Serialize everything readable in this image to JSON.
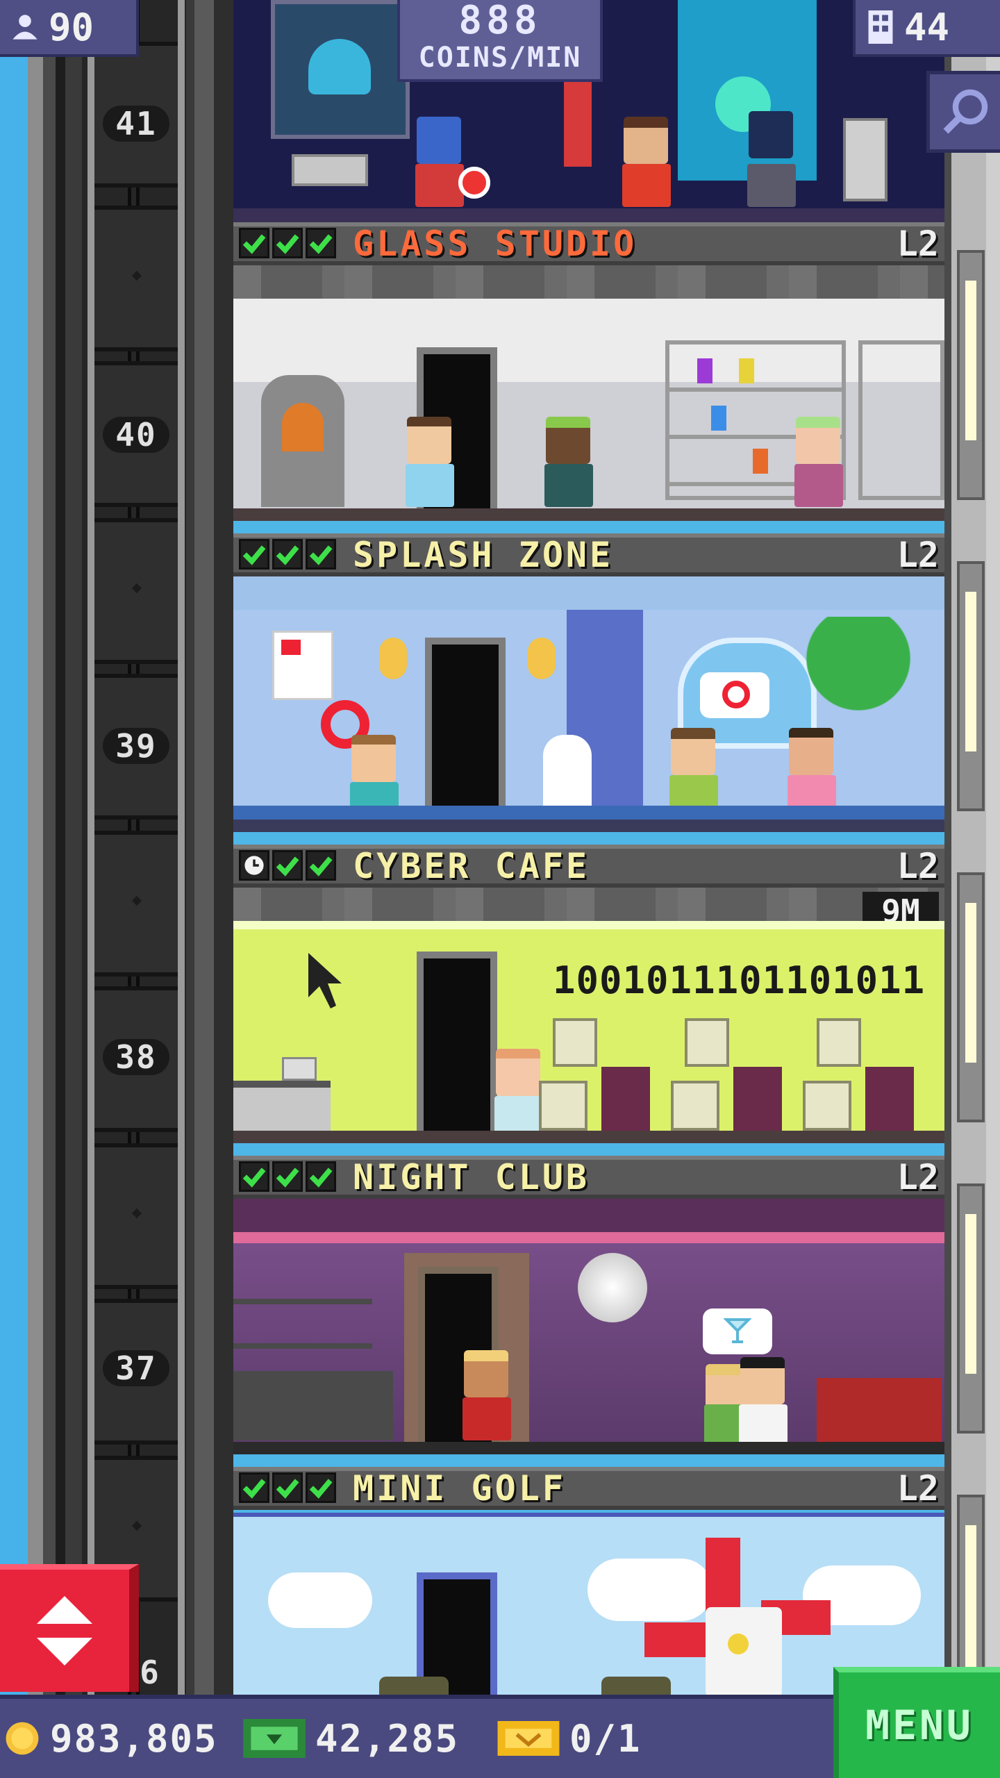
{
  "topbar": {
    "population": "90",
    "coins_rate_value": "888",
    "coins_rate_unit": "COINS/MIN",
    "floors_count": "44"
  },
  "shaft": {
    "floor_numbers": [
      "41",
      "40",
      "39",
      "38",
      "37",
      "6"
    ]
  },
  "floors": [
    {
      "name": "GLASS STUDIO",
      "level": "L2",
      "checks": [
        "check",
        "check",
        "check"
      ],
      "name_color": "#ff6a3c"
    },
    {
      "name": "SPLASH ZONE",
      "level": "L2",
      "checks": [
        "check",
        "check",
        "check"
      ],
      "name_color": "#f6f0a8"
    },
    {
      "name": "CYBER CAFE",
      "level": "L2",
      "checks": [
        "clock",
        "check",
        "check"
      ],
      "name_color": "#f6f0a8",
      "timer": "9M",
      "screen_text": "1001011101101011"
    },
    {
      "name": "NIGHT CLUB",
      "level": "L2",
      "checks": [
        "check",
        "check",
        "check"
      ],
      "name_color": "#f6f0a8"
    },
    {
      "name": "MINI GOLF",
      "level": "L2",
      "checks": [
        "check",
        "check",
        "check"
      ],
      "name_color": "#f6f0a8"
    }
  ],
  "bottombar": {
    "coins": "983,805",
    "bux": "42,285",
    "tickets": "0/1",
    "menu_label": "MENU"
  },
  "colors": {
    "check_green": "#3ee04a",
    "menu_green": "#26b74b",
    "elevator_button_red": "#e8243d",
    "bar_purple": "#4a4a80"
  },
  "icons": [
    "population-icon",
    "floors-icon",
    "zoom-icon",
    "elevator-updown-icon",
    "coin-icon",
    "bux-icon",
    "ticket-icon",
    "check-icon",
    "clock-icon"
  ]
}
